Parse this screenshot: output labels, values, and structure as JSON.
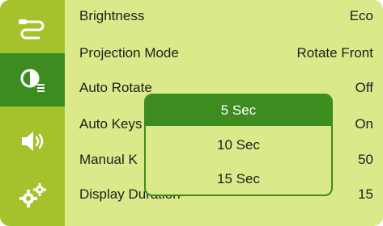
{
  "sidebar": {
    "items": [
      {
        "name": "cable-icon",
        "active": false
      },
      {
        "name": "brightness-settings-icon",
        "active": true
      },
      {
        "name": "volume-icon",
        "active": false
      },
      {
        "name": "gears-icon",
        "active": false
      }
    ]
  },
  "menu": {
    "rows": [
      {
        "label": "Brightness",
        "value": "Eco"
      },
      {
        "label": "Projection Mode",
        "value": "Rotate Front"
      },
      {
        "label": "Auto Rotate",
        "value": "Off"
      },
      {
        "label": "Auto Keys",
        "value": "On"
      },
      {
        "label": "Manual K",
        "value": "50"
      },
      {
        "label": "Display Duration",
        "value": "15"
      }
    ]
  },
  "popup": {
    "options": [
      "5 Sec",
      "10 Sec",
      "15 Sec"
    ],
    "selected": "5 Sec"
  },
  "colors": {
    "background": "#dbe98a",
    "sidebar": "#a4c22b",
    "accent": "#3d8c1f",
    "text": "#1e1e1e"
  }
}
